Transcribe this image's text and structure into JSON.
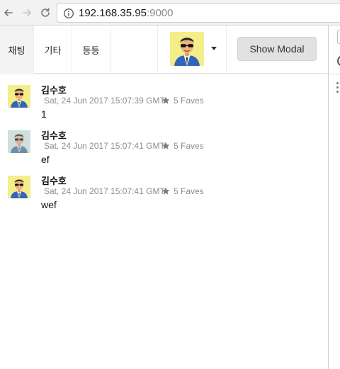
{
  "browser": {
    "url_host": "192.168.35.95",
    "url_port": ":9000"
  },
  "nav": {
    "tabs": [
      {
        "label": "채팅"
      },
      {
        "label": "기타"
      },
      {
        "label": "등등"
      }
    ],
    "modal_button_label": "Show Modal"
  },
  "messages": [
    {
      "author": "김수호",
      "time": "Sat, 24 Jun 2017 15:07:39 GMT",
      "faves": "5 Faves",
      "text": "1"
    },
    {
      "author": "김수호",
      "time": "Sat, 24 Jun 2017 15:07:41 GMT",
      "faves": "5 Faves",
      "text": "ef"
    },
    {
      "author": "김수호",
      "time": "Sat, 24 Jun 2017 15:07:41 GMT",
      "faves": "5 Faves",
      "text": "wef"
    }
  ],
  "colors": {
    "avatar_background": "#f4ee8a",
    "avatar_background_muted": "#cfe0dc",
    "star": "#7a7a7a"
  },
  "icons": [
    "back-arrow-icon",
    "forward-arrow-icon",
    "reload-icon",
    "info-icon",
    "caret-down-icon",
    "star-icon",
    "avatar"
  ]
}
